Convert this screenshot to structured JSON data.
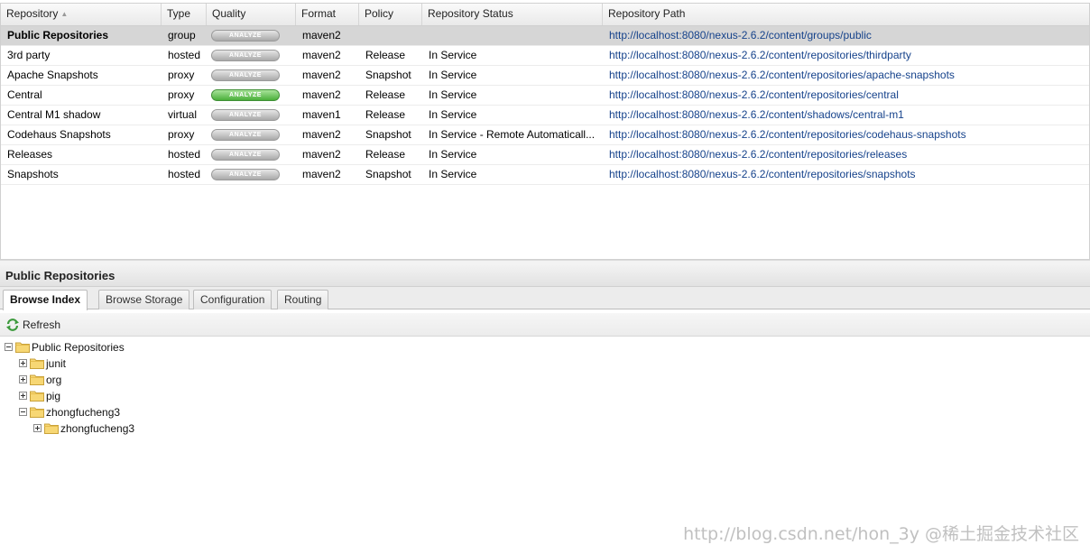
{
  "grid": {
    "columns": [
      "Repository",
      "Type",
      "Quality",
      "Format",
      "Policy",
      "Repository Status",
      "Repository Path"
    ],
    "rows": [
      {
        "name": "Public Repositories",
        "type": "group",
        "quality": "ANALYZE",
        "format": "maven2",
        "policy": "",
        "status": "",
        "path": "http://localhost:8080/nexus-2.6.2/content/groups/public",
        "selected": true,
        "quality_active": false
      },
      {
        "name": "3rd party",
        "type": "hosted",
        "quality": "ANALYZE",
        "format": "maven2",
        "policy": "Release",
        "status": "In Service",
        "path": "http://localhost:8080/nexus-2.6.2/content/repositories/thirdparty",
        "selected": false,
        "quality_active": false
      },
      {
        "name": "Apache Snapshots",
        "type": "proxy",
        "quality": "ANALYZE",
        "format": "maven2",
        "policy": "Snapshot",
        "status": "In Service",
        "path": "http://localhost:8080/nexus-2.6.2/content/repositories/apache-snapshots",
        "selected": false,
        "quality_active": false
      },
      {
        "name": "Central",
        "type": "proxy",
        "quality": "ANALYZE",
        "format": "maven2",
        "policy": "Release",
        "status": "In Service",
        "path": "http://localhost:8080/nexus-2.6.2/content/repositories/central",
        "selected": false,
        "quality_active": true
      },
      {
        "name": "Central M1 shadow",
        "type": "virtual",
        "quality": "ANALYZE",
        "format": "maven1",
        "policy": "Release",
        "status": "In Service",
        "path": "http://localhost:8080/nexus-2.6.2/content/shadows/central-m1",
        "selected": false,
        "quality_active": false
      },
      {
        "name": "Codehaus Snapshots",
        "type": "proxy",
        "quality": "ANALYZE",
        "format": "maven2",
        "policy": "Snapshot",
        "status": "In Service - Remote Automaticall...",
        "path": "http://localhost:8080/nexus-2.6.2/content/repositories/codehaus-snapshots",
        "selected": false,
        "quality_active": false
      },
      {
        "name": "Releases",
        "type": "hosted",
        "quality": "ANALYZE",
        "format": "maven2",
        "policy": "Release",
        "status": "In Service",
        "path": "http://localhost:8080/nexus-2.6.2/content/repositories/releases",
        "selected": false,
        "quality_active": false
      },
      {
        "name": "Snapshots",
        "type": "hosted",
        "quality": "ANALYZE",
        "format": "maven2",
        "policy": "Snapshot",
        "status": "In Service",
        "path": "http://localhost:8080/nexus-2.6.2/content/repositories/snapshots",
        "selected": false,
        "quality_active": false
      }
    ]
  },
  "panel": {
    "title": "Public Repositories",
    "tabs": [
      {
        "label": "Browse Index",
        "active": true
      },
      {
        "label": "Browse Storage",
        "active": false
      },
      {
        "label": "Configuration",
        "active": false
      },
      {
        "label": "Routing",
        "active": false
      }
    ],
    "toolbar": {
      "refresh_label": "Refresh",
      "refresh_icon": "refresh-icon"
    }
  },
  "tree": [
    {
      "label": "Public Repositories",
      "depth": 0,
      "expanded": true
    },
    {
      "label": "junit",
      "depth": 1,
      "expanded": false
    },
    {
      "label": "org",
      "depth": 1,
      "expanded": false
    },
    {
      "label": "pig",
      "depth": 1,
      "expanded": false
    },
    {
      "label": "zhongfucheng3",
      "depth": 1,
      "expanded": true
    },
    {
      "label": "zhongfucheng3",
      "depth": 2,
      "expanded": false
    }
  ],
  "watermark": "http://blog.csdn.net/hon_3y  @稀土掘金技术社区",
  "colors": {
    "selected_row": "#d6d6d6",
    "link": "#15428b",
    "analyze_active": "#4aaf3a",
    "analyze_inactive": "#a9a9a9"
  }
}
